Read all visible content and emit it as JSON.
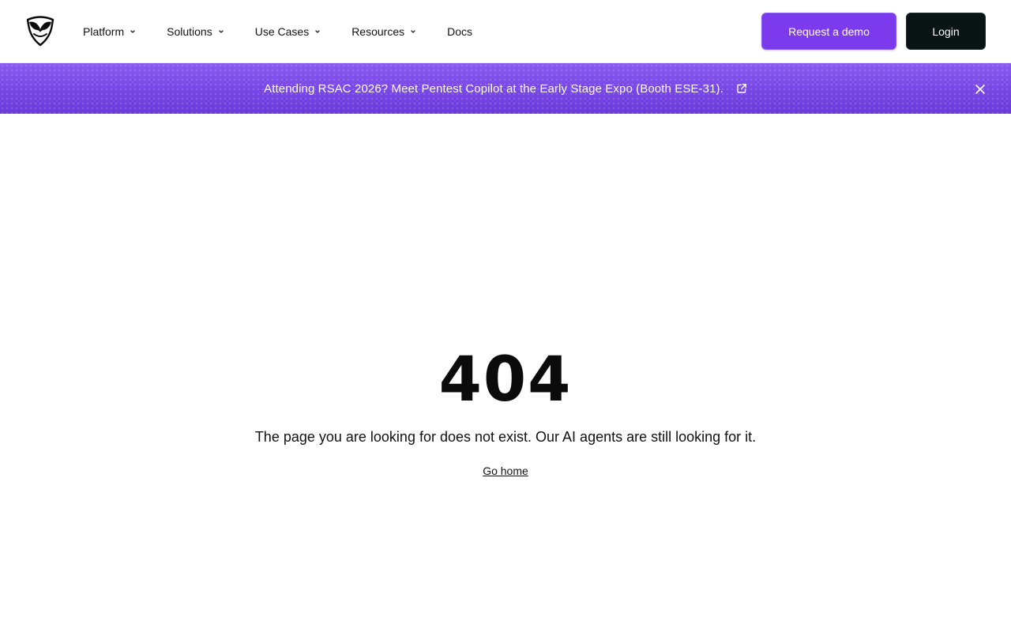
{
  "header": {
    "nav": [
      {
        "label": "Platform",
        "has_dropdown": true
      },
      {
        "label": "Solutions",
        "has_dropdown": true
      },
      {
        "label": "Use Cases",
        "has_dropdown": true
      },
      {
        "label": "Resources",
        "has_dropdown": true
      },
      {
        "label": "Docs",
        "has_dropdown": false
      }
    ],
    "demo_label": "Request a demo",
    "login_label": "Login"
  },
  "banner": {
    "text": "Attending RSAC 2026? Meet Pentest Copilot at the Early Stage Expo (Booth ESE-31).",
    "link_icon": "external-link-icon",
    "close_icon": "close-icon"
  },
  "error": {
    "code": "404",
    "message": "The page you are looking for does not exist. Our AI agents are still looking for it.",
    "home_link": "Go home"
  },
  "colors": {
    "accent": "#7c3aed",
    "banner": "#7c4de8",
    "login_bg": "#0a1414",
    "text": "#0b0b0b"
  }
}
